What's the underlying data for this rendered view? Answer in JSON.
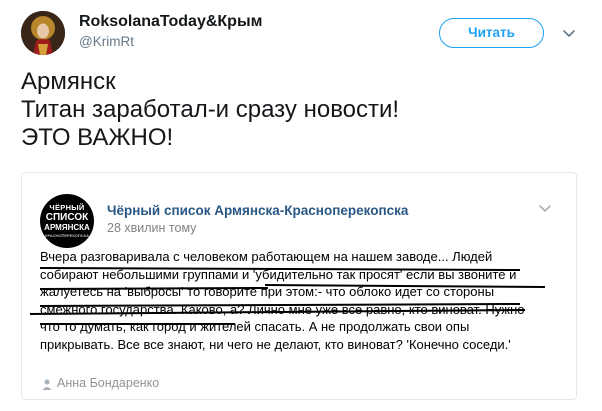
{
  "tweet": {
    "display_name": "RoksolanaToday&Крым",
    "handle": "@KrimRt",
    "follow_label": "Читать",
    "text_lines": [
      "Армянск",
      "Титан заработал-и сразу новости!",
      "ЭТО ВАЖНО!"
    ]
  },
  "card": {
    "group_name": "Чёрный список Армянска-Красноперекопска",
    "post_time": "28 хвилин тому",
    "logo_text": [
      "ЧЁРНЫЙ",
      "СПИСОК",
      "АРМЯНСКА",
      "КРАСНОПЕРЕКОПСКА"
    ],
    "body_lines": [
      "Вчера разговаривала с человеком работающем на нашем заводе... Людей",
      "собирают небольшими группами и 'убидительно так просят' если вы звоните и",
      "жалуетесь на 'выбросы' то говорите при этом:- что облоко идет со стороны",
      "смежного государства. Каково, а? Лично мне уже все равно, кто виноват. Нужно",
      "что то думать, как город и жителей спасать. А не продолжать свои опы",
      "прикрывать. Все все знают, ни чего не делают, кто виноват? 'Конечно соседи.'"
    ],
    "author": "Анна Бондаренко"
  },
  "colors": {
    "accent": "#1da1f2",
    "link": "#2a5885",
    "muted": "#657786",
    "underline": "#000000"
  },
  "icons": {
    "caret": "chevron-down-icon",
    "card_menu": "chevron-down-icon",
    "author": "person-icon"
  }
}
